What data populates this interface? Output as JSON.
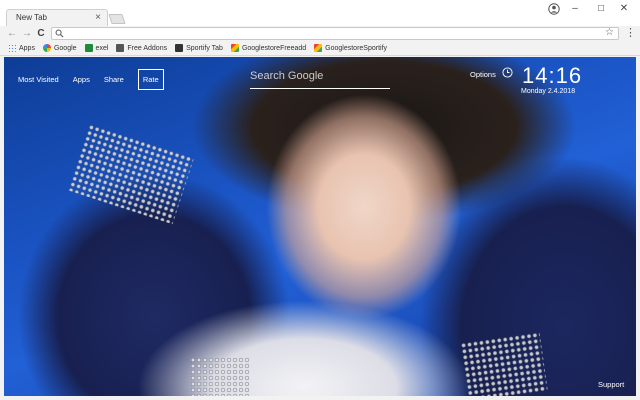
{
  "tabs": [
    {
      "title": "New Tab",
      "close": "×"
    }
  ],
  "window": {
    "minimize": "–",
    "maximize": "□",
    "close": "✕"
  },
  "toolbar": {
    "back": "←",
    "forward": "→",
    "reload": "C",
    "address_value": "",
    "star": "☆",
    "menu": "⋮"
  },
  "bookmarks": [
    {
      "label": "Apps",
      "icon": "apps-icon"
    },
    {
      "label": "Google",
      "icon": "google-icon"
    },
    {
      "label": "exel",
      "icon": "sheets-icon"
    },
    {
      "label": "Free Addons",
      "icon": "addons-icon"
    },
    {
      "label": "Sportify Tab",
      "icon": "spotify-tab-icon"
    },
    {
      "label": "GooglestoreFreeadd",
      "icon": "store-icon"
    },
    {
      "label": "GooglestoreSportify",
      "icon": "store-icon"
    }
  ],
  "ntp": {
    "nav": [
      "Most Visited",
      "Apps",
      "Share",
      "Rate"
    ],
    "search_placeholder": "Search Google",
    "options": "Options",
    "time": "14:16",
    "date": "Monday  2.4.2018",
    "support": "Support"
  }
}
